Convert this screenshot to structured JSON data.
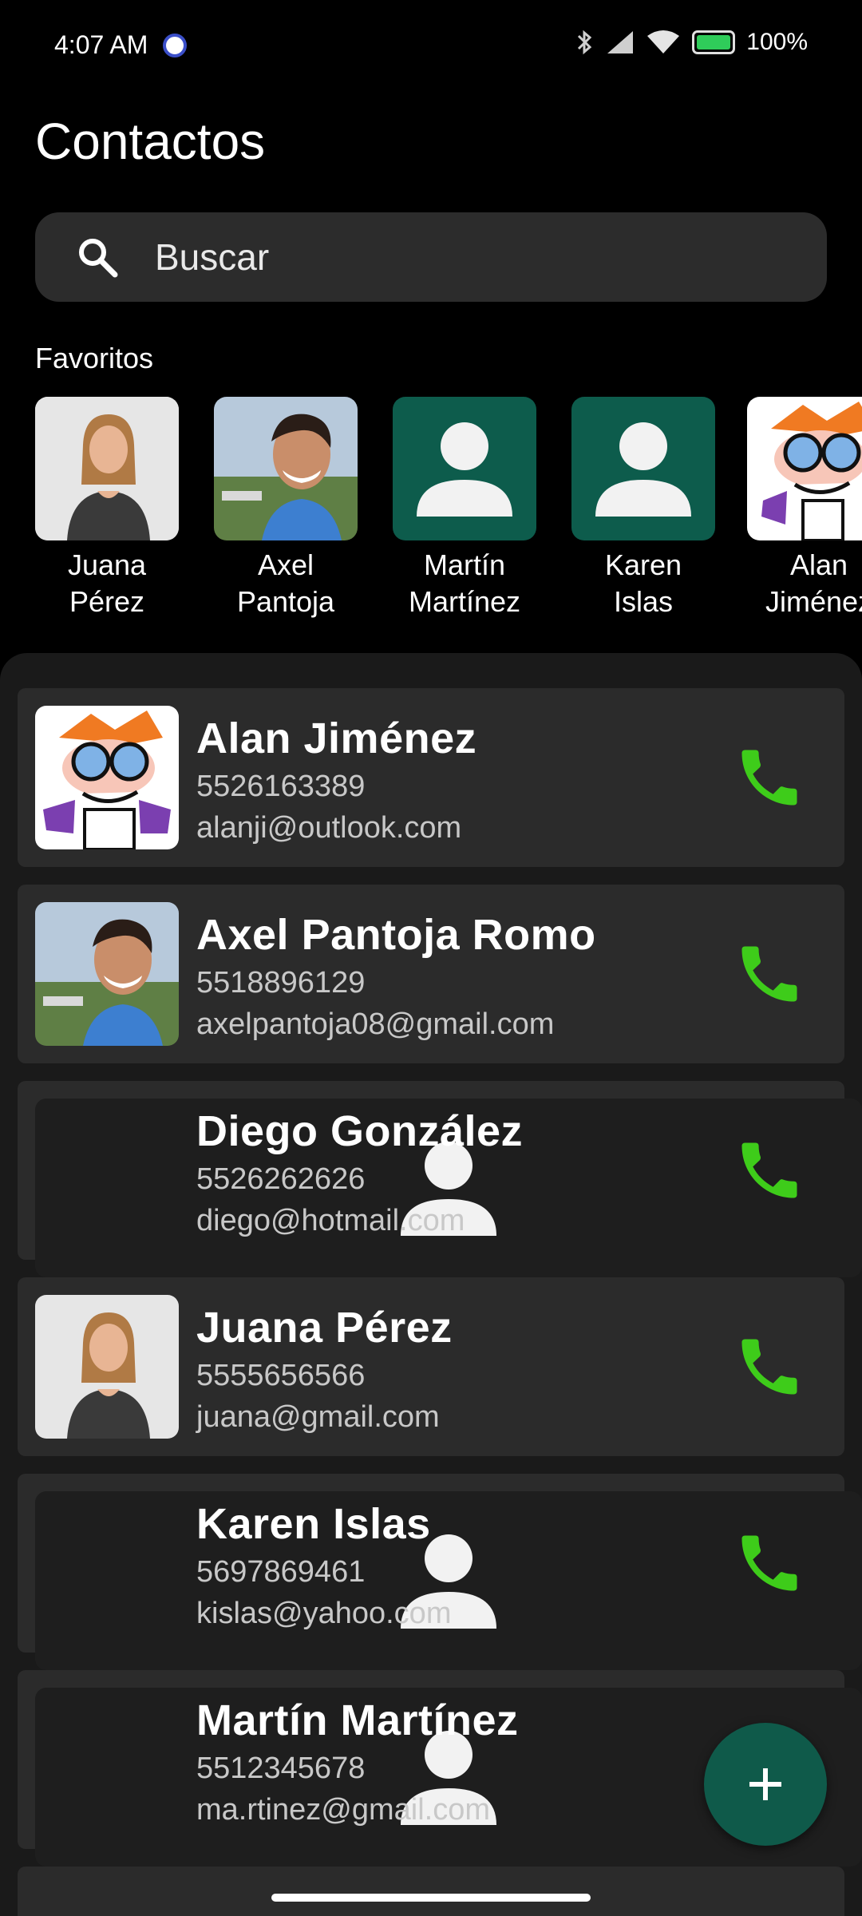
{
  "status_bar": {
    "time": "4:07 AM",
    "battery_text": "100%"
  },
  "header": {
    "title": "Contactos"
  },
  "search": {
    "placeholder": "Buscar"
  },
  "favorites": {
    "label": "Favoritos",
    "items": [
      {
        "first": "Juana",
        "last": "Pérez",
        "avatar": "photo-woman"
      },
      {
        "first": "Axel",
        "last": "Pantoja",
        "avatar": "photo-man"
      },
      {
        "first": "Martín",
        "last": "Martínez",
        "avatar": "placeholder"
      },
      {
        "first": "Karen",
        "last": "Islas",
        "avatar": "placeholder"
      },
      {
        "first": "Alan",
        "last": "Jiménez",
        "avatar": "cartoon"
      }
    ]
  },
  "contacts": [
    {
      "name": "Alan Jiménez",
      "phone": "5526163389",
      "email": "alanji@outlook.com",
      "avatar": "cartoon"
    },
    {
      "name": "Axel Pantoja Romo",
      "phone": "5518896129",
      "email": "axelpantoja08@gmail.com",
      "avatar": "photo-man"
    },
    {
      "name": "Diego González",
      "phone": "5526262626",
      "email": "diego@hotmail.com",
      "avatar": "placeholder"
    },
    {
      "name": "Juana Pérez",
      "phone": "5555656566",
      "email": "juana@gmail.com",
      "avatar": "photo-woman"
    },
    {
      "name": "Karen Islas",
      "phone": "5697869461",
      "email": "kislas@yahoo.com",
      "avatar": "placeholder"
    },
    {
      "name": "Martín Martínez",
      "phone": "5512345678",
      "email": "ma.rtinez@gmail.com",
      "avatar": "placeholder"
    }
  ],
  "colors": {
    "call_green": "#3ecc1a",
    "placeholder_bg_favorites": "#0d5c4c",
    "placeholder_bg_list": "#1e1e1e",
    "fab_bg": "#0f5a4a"
  },
  "icons": {
    "search": "search-icon",
    "call": "phone-icon",
    "fab": "plus-icon",
    "placeholder": "person-icon"
  }
}
